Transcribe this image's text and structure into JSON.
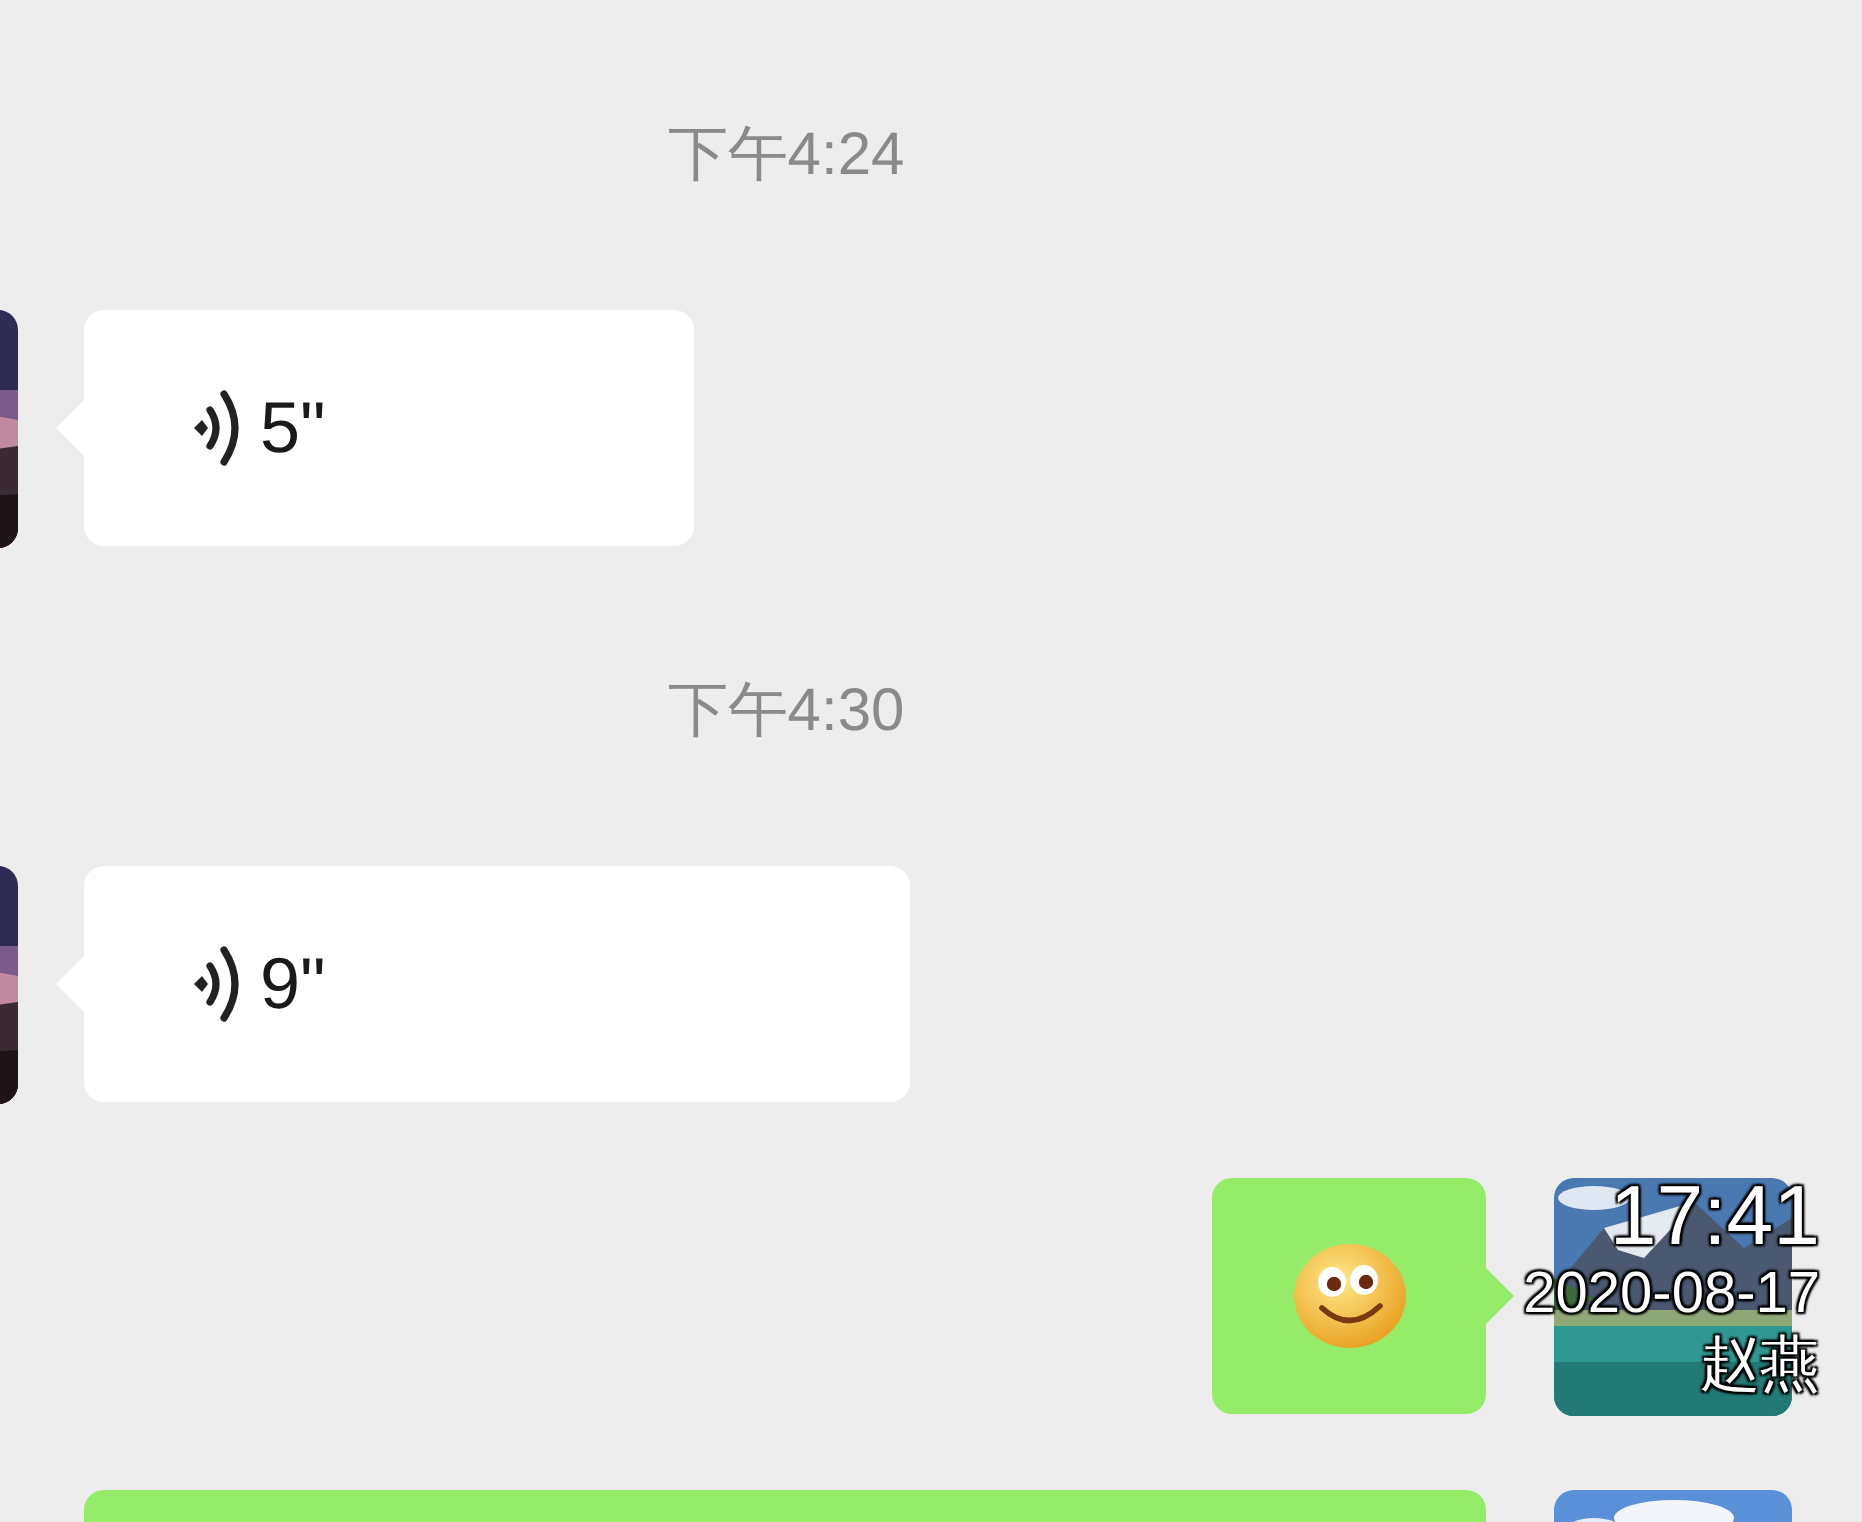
{
  "messages": [
    {
      "kind": "time",
      "text": "下午4:24"
    },
    {
      "kind": "voice",
      "sent": false,
      "duration": "5\""
    },
    {
      "kind": "time",
      "text": "下午4:30"
    },
    {
      "kind": "voice",
      "sent": false,
      "duration": "9\""
    },
    {
      "kind": "emoji",
      "sent": true
    },
    {
      "kind": "bubble",
      "sent": true
    }
  ],
  "overlay": {
    "time": "17:41",
    "date": "2020-08-17",
    "name": "赵燕"
  }
}
